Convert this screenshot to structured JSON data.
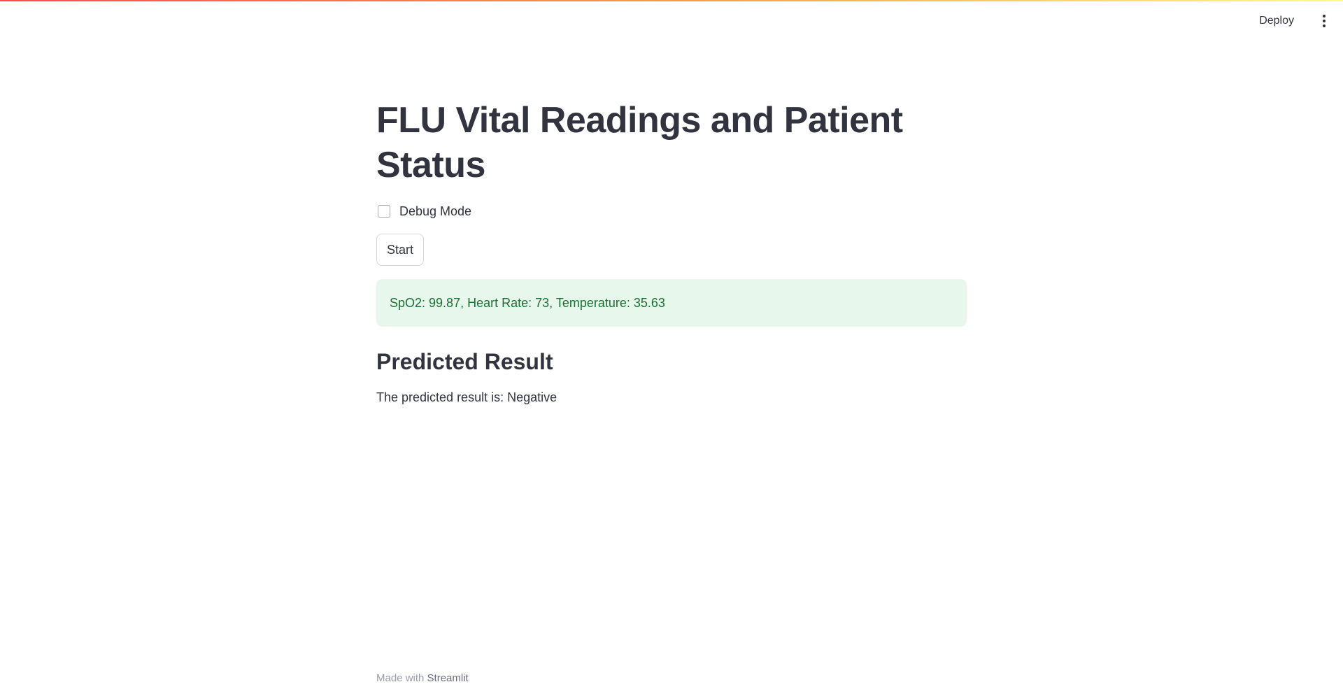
{
  "header": {
    "deploy_label": "Deploy",
    "menu_icon": "vertical-ellipsis-icon"
  },
  "main": {
    "title": "FLU Vital Readings and Patient Status",
    "debug_checkbox": {
      "label": "Debug Mode",
      "checked": false
    },
    "start_label": "Start",
    "status_message": "SpO2: 99.87, Heart Rate: 73, Temperature: 35.63",
    "result_heading": "Predicted Result",
    "result_text": "The predicted result is: Negative"
  },
  "footer": {
    "prefix": "Made with ",
    "brand": "Streamlit"
  },
  "colors": {
    "accent": "#ff4b4b",
    "text": "#31333f",
    "success_bg": "#e8f7ec",
    "success_text": "#177233"
  }
}
